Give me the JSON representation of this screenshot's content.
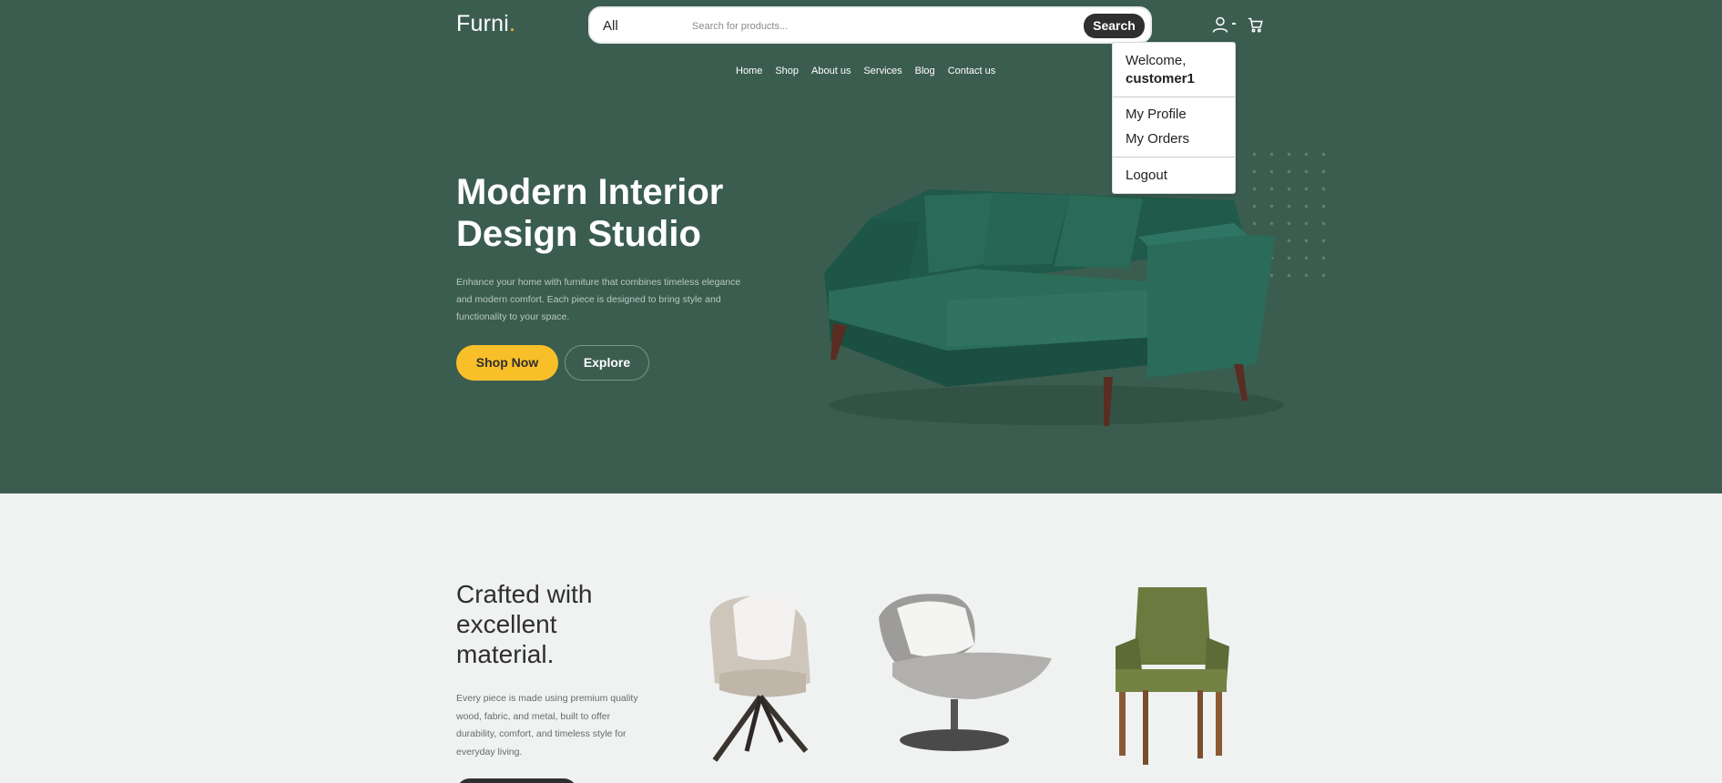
{
  "header": {
    "logo_text": "Furni",
    "logo_dot": ".",
    "search_category": "All",
    "search_placeholder": "Search for products...",
    "search_button": "Search"
  },
  "nav": [
    "Home",
    "Shop",
    "About us",
    "Services",
    "Blog",
    "Contact us"
  ],
  "account_menu": {
    "welcome": "Welcome,",
    "username": "customer1",
    "items": [
      "My Profile",
      "My Orders",
      "Logout"
    ]
  },
  "hero": {
    "title_line1": "Modern Interior",
    "title_line2": "Design Studio",
    "description": "Enhance your home with furniture that combines timeless elegance and modern comfort. Each piece is designed to bring style and functionality to your space.",
    "primary_button": "Shop Now",
    "secondary_button": "Explore"
  },
  "section2": {
    "title": "Crafted with excellent material.",
    "description": "Every piece is made using premium quality wood, fabric, and metal, built to offer durability, comfort, and timeless style for everyday living."
  },
  "colors": {
    "hero_bg": "#3b5d50",
    "accent": "#f9bf29",
    "page_bg": "#eff2f1",
    "dark": "#2f2f2f"
  },
  "icons": [
    "user-icon",
    "cart-icon"
  ]
}
